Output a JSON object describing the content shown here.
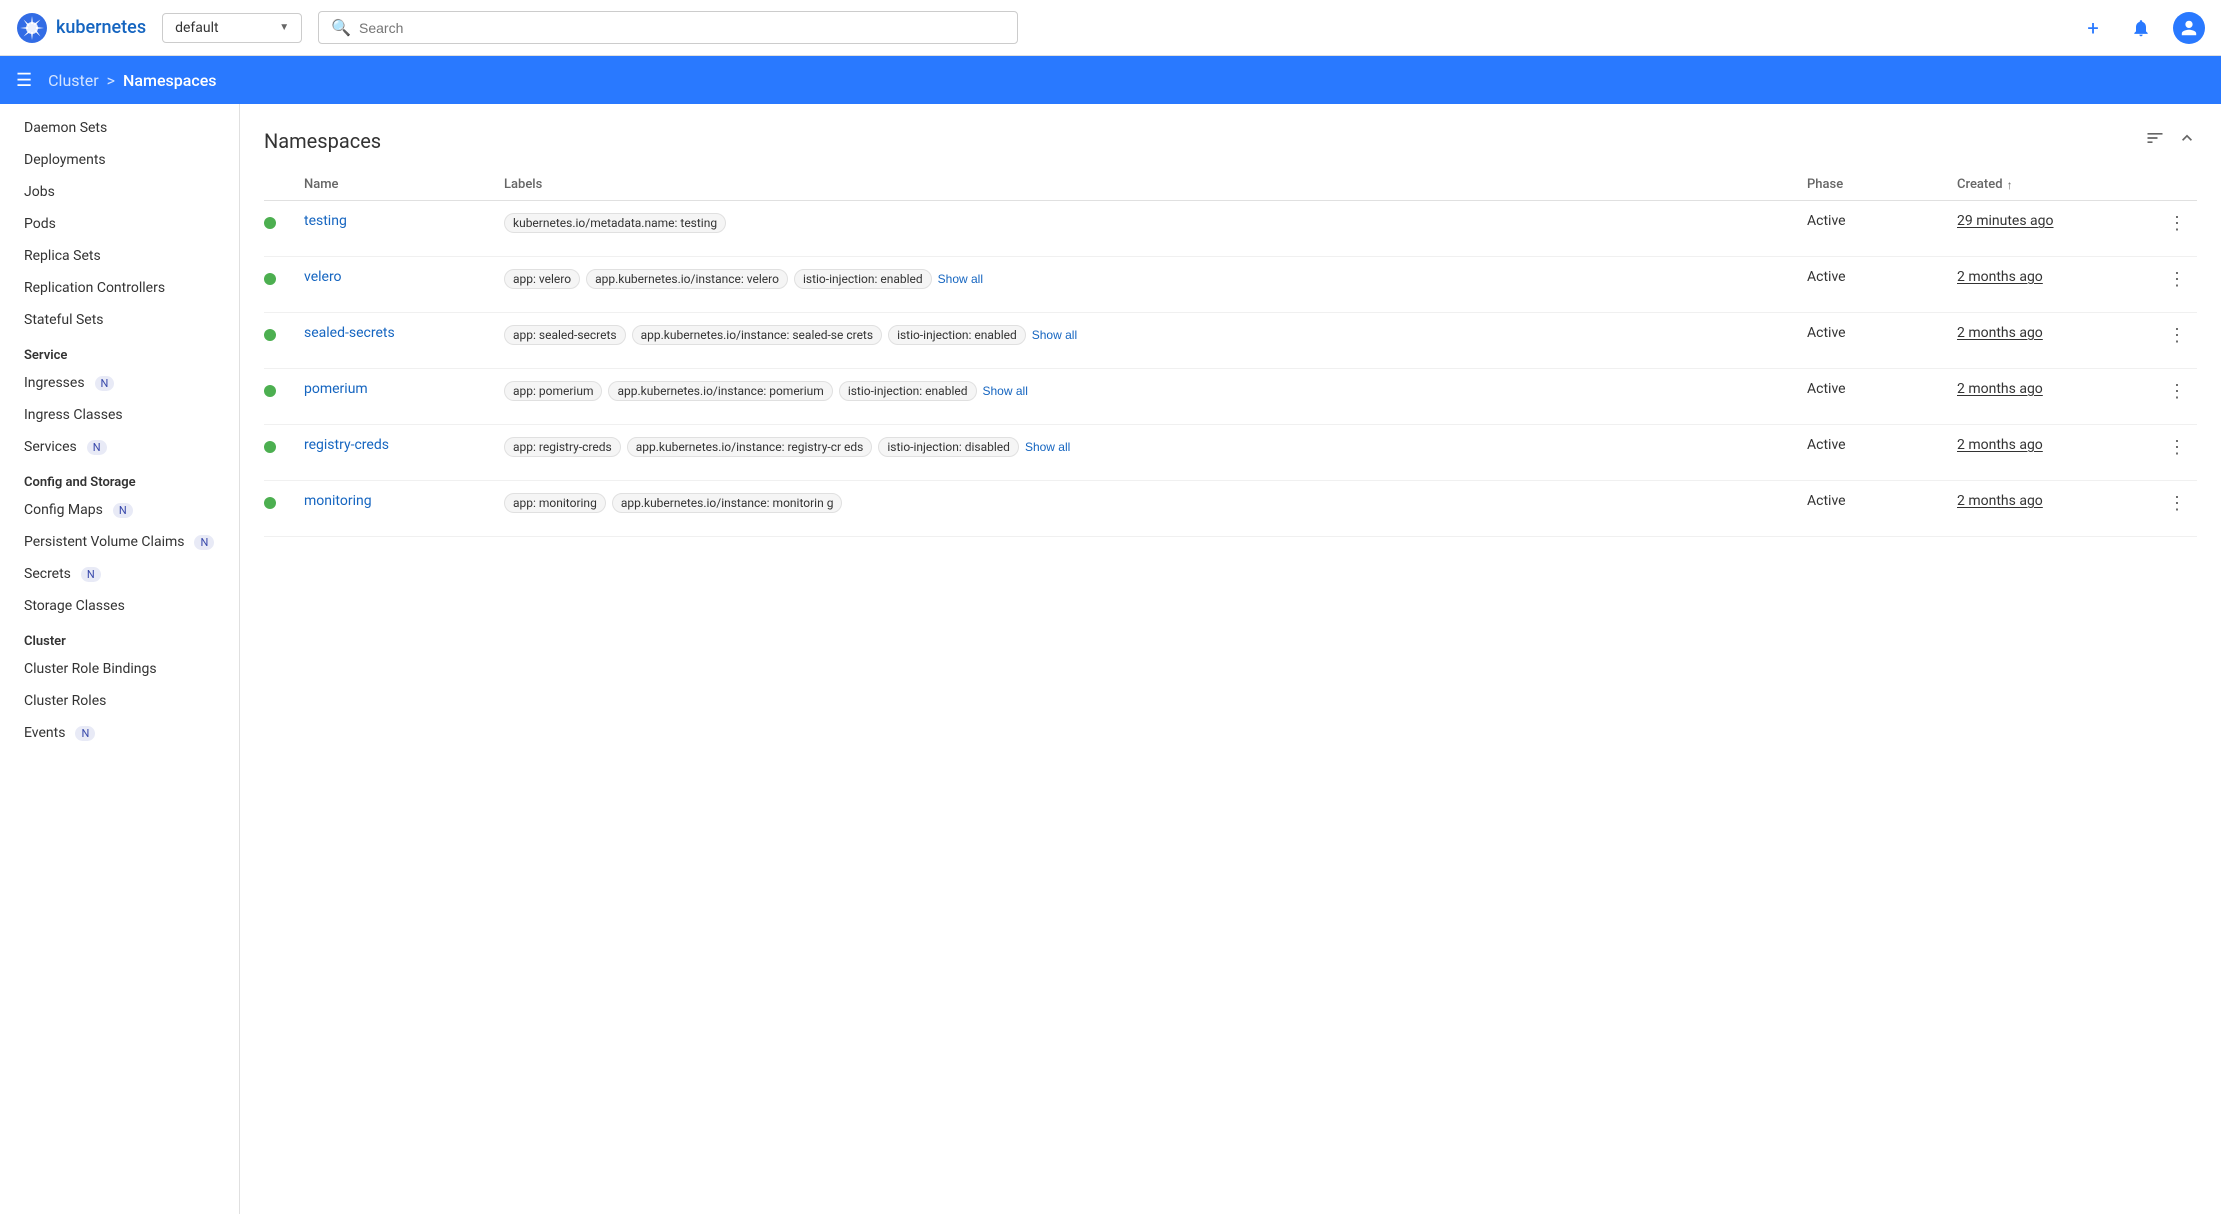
{
  "app": {
    "name": "kubernetes",
    "logo_alt": "kubernetes-logo"
  },
  "topnav": {
    "namespace": "default",
    "search_placeholder": "Search",
    "add_label": "+",
    "bell_label": "🔔",
    "avatar_label": "👤"
  },
  "breadcrumb": {
    "menu_icon": "☰",
    "parent": "Cluster",
    "separator": ">",
    "current": "Namespaces"
  },
  "sidebar": {
    "items": [
      {
        "label": "Daemon Sets",
        "section": null,
        "badge": null
      },
      {
        "label": "Deployments",
        "section": null,
        "badge": null
      },
      {
        "label": "Jobs",
        "section": null,
        "badge": null
      },
      {
        "label": "Pods",
        "section": null,
        "badge": null
      },
      {
        "label": "Replica Sets",
        "section": null,
        "badge": null
      },
      {
        "label": "Replication Controllers",
        "section": null,
        "badge": null
      },
      {
        "label": "Stateful Sets",
        "section": null,
        "badge": null
      },
      {
        "label": "Service",
        "section": true,
        "badge": null
      },
      {
        "label": "Ingresses",
        "section": false,
        "badge": "N"
      },
      {
        "label": "Ingress Classes",
        "section": false,
        "badge": null
      },
      {
        "label": "Services",
        "section": false,
        "badge": "N"
      },
      {
        "label": "Config and Storage",
        "section": true,
        "badge": null
      },
      {
        "label": "Config Maps",
        "section": false,
        "badge": "N"
      },
      {
        "label": "Persistent Volume Claims",
        "section": false,
        "badge": "N"
      },
      {
        "label": "Secrets",
        "section": false,
        "badge": "N"
      },
      {
        "label": "Storage Classes",
        "section": false,
        "badge": null
      },
      {
        "label": "Cluster",
        "section": true,
        "badge": null
      },
      {
        "label": "Cluster Role Bindings",
        "section": false,
        "badge": null
      },
      {
        "label": "Cluster Roles",
        "section": false,
        "badge": null
      },
      {
        "label": "Events",
        "section": false,
        "badge": "N"
      }
    ]
  },
  "page": {
    "title": "Namespaces",
    "filter_icon": "filter",
    "collapse_icon": "collapse"
  },
  "table": {
    "columns": [
      "",
      "Name",
      "Labels",
      "Phase",
      "Created",
      ""
    ],
    "created_sort_icon": "↑",
    "rows": [
      {
        "status": "active",
        "name": "testing",
        "labels": [
          {
            "text": "kubernetes.io/metadata.name: testing"
          }
        ],
        "labels_extra": null,
        "phase": "Active",
        "created": "29 minutes ago"
      },
      {
        "status": "active",
        "name": "velero",
        "labels": [
          {
            "text": "app: velero"
          },
          {
            "text": "app.kubernetes.io/instance: velero"
          },
          {
            "text": "istio-injection: enabled"
          }
        ],
        "labels_extra": "Show all",
        "phase": "Active",
        "created": "2 months ago"
      },
      {
        "status": "active",
        "name": "sealed-secrets",
        "labels": [
          {
            "text": "app: sealed-secrets"
          },
          {
            "text": "app.kubernetes.io/instance: sealed-se crets"
          },
          {
            "text": "istio-injection: enabled"
          }
        ],
        "labels_extra": "Show all",
        "phase": "Active",
        "created": "2 months ago"
      },
      {
        "status": "active",
        "name": "pomerium",
        "labels": [
          {
            "text": "app: pomerium"
          },
          {
            "text": "app.kubernetes.io/instance: pomerium"
          },
          {
            "text": "istio-injection: enabled"
          }
        ],
        "labels_extra": "Show all",
        "phase": "Active",
        "created": "2 months ago"
      },
      {
        "status": "active",
        "name": "registry-creds",
        "labels": [
          {
            "text": "app: registry-creds"
          },
          {
            "text": "app.kubernetes.io/instance: registry-cr eds"
          },
          {
            "text": "istio-injection: disabled"
          }
        ],
        "labels_extra": "Show all",
        "phase": "Active",
        "created": "2 months ago"
      },
      {
        "status": "active",
        "name": "monitoring",
        "labels": [
          {
            "text": "app: monitoring"
          },
          {
            "text": "app.kubernetes.io/instance: monitorin g"
          }
        ],
        "labels_extra": null,
        "phase": "Active",
        "created": "2 months ago"
      }
    ]
  }
}
